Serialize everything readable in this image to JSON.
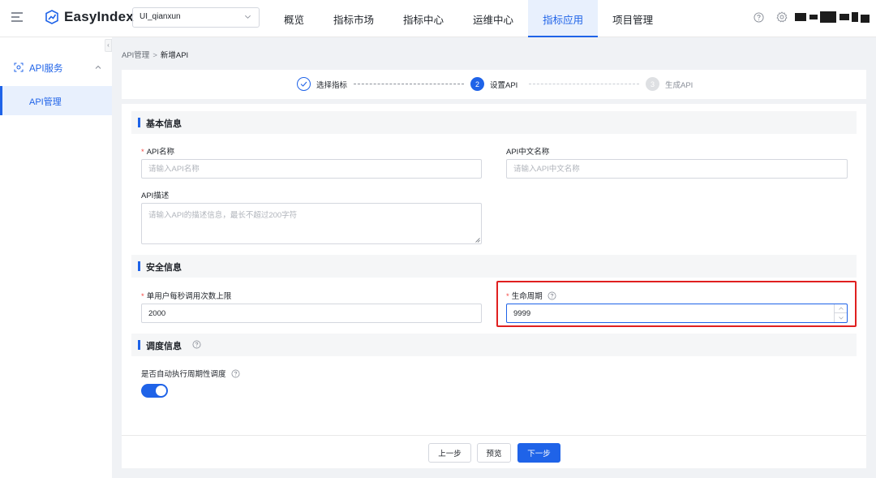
{
  "header": {
    "logo_text": "EasyIndex",
    "project_select": "UI_qianxun",
    "nav": [
      "概览",
      "指标市场",
      "指标中心",
      "运维中心",
      "指标应用",
      "项目管理"
    ],
    "active_nav": "指标应用"
  },
  "sidebar": {
    "group_label": "API服务",
    "item_label": "API管理"
  },
  "breadcrumb": {
    "parent": "API管理",
    "separator": ">",
    "current": "新增API"
  },
  "steps": [
    {
      "index": "",
      "label": "选择指标",
      "status": "done"
    },
    {
      "index": "2",
      "label": "设置API",
      "status": "active"
    },
    {
      "index": "3",
      "label": "生成API",
      "status": "pending"
    }
  ],
  "sections": {
    "basic": "基本信息",
    "security": "安全信息",
    "schedule": "调度信息"
  },
  "fields": {
    "api_name": {
      "required": "*",
      "label": "API名称",
      "placeholder": "请输入API名称"
    },
    "api_cn_name": {
      "label": "API中文名称",
      "placeholder": "请输入API中文名称"
    },
    "api_desc": {
      "label": "API描述",
      "placeholder": "请输入API的描述信息，最长不超过200字符"
    },
    "rate_limit": {
      "required": "*",
      "label": "单用户每秒调用次数上限",
      "value": "2000"
    },
    "lifecycle": {
      "required": "*",
      "label": "生命周期",
      "value": "9999"
    },
    "auto_schedule": {
      "label": "是否自动执行周期性调度",
      "enabled": true
    }
  },
  "footer": {
    "prev": "上一步",
    "preview": "预览",
    "next": "下一步"
  },
  "colors": {
    "primary": "#1f63e8",
    "highlight": "#e02020",
    "required": "#f54a45"
  }
}
